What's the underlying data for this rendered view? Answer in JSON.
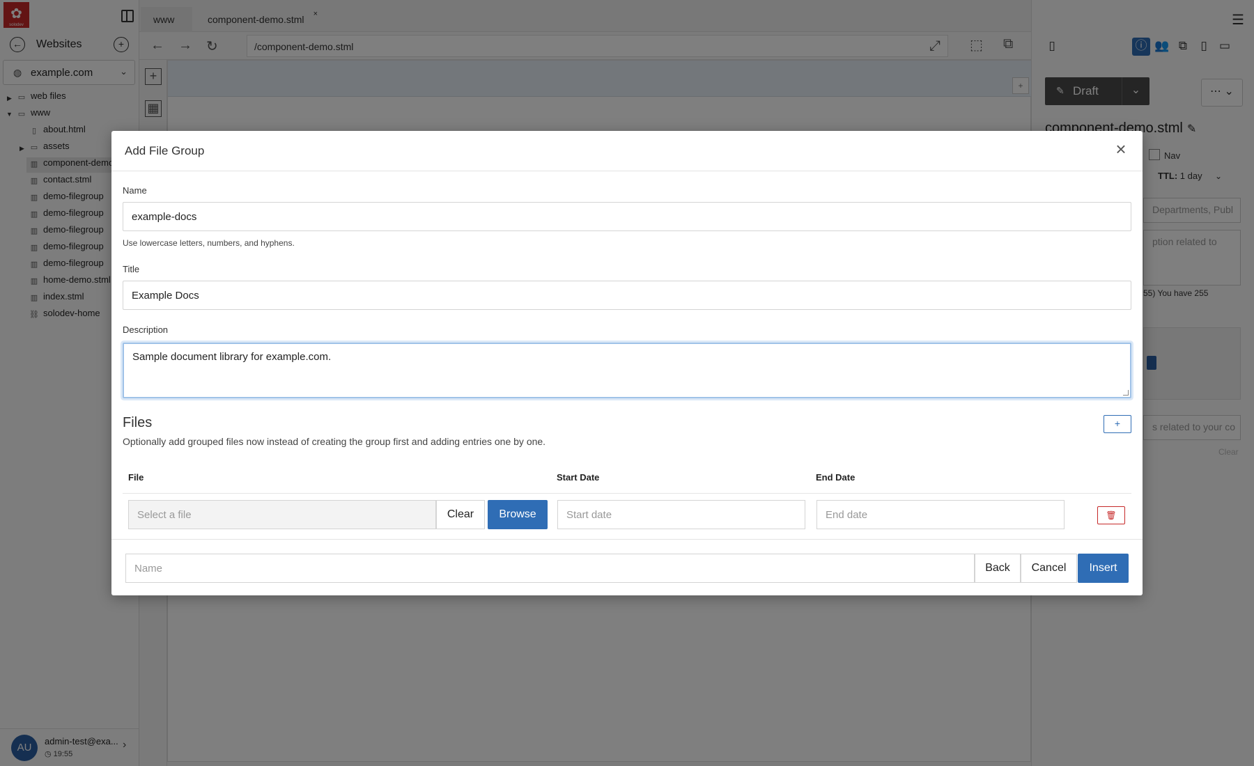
{
  "app": {
    "logo_text": "solodev",
    "colors": {
      "accent": "#2f6db5",
      "brand": "#c62828",
      "danger": "#c62828",
      "avatar": "#2b5fa3"
    }
  },
  "sidebar": {
    "title": "Websites",
    "site": "example.com",
    "tree": [
      {
        "label": "web files",
        "type": "folder"
      },
      {
        "label": "www",
        "type": "folder"
      },
      {
        "label": "about.html",
        "type": "file"
      },
      {
        "label": "assets",
        "type": "folder"
      },
      {
        "label": "component-demo.stml",
        "type": "stml"
      },
      {
        "label": "contact.stml",
        "type": "stml"
      },
      {
        "label": "demo-filegroup",
        "type": "stml"
      },
      {
        "label": "demo-filegroup",
        "type": "stml"
      },
      {
        "label": "demo-filegroup",
        "type": "stml"
      },
      {
        "label": "demo-filegroup",
        "type": "stml"
      },
      {
        "label": "demo-filegroup",
        "type": "stml"
      },
      {
        "label": "home-demo.stml",
        "type": "stml"
      },
      {
        "label": "index.stml",
        "type": "stml"
      },
      {
        "label": "solodev-home",
        "type": "link"
      }
    ],
    "user": {
      "initials": "AU",
      "name": "admin-test@exa...",
      "time": "19:55"
    }
  },
  "editor": {
    "tabs": [
      "www",
      "component-demo.stml"
    ],
    "url": "/component-demo.stml"
  },
  "right_panel": {
    "status": "Draft",
    "file_title": "component-demo.stml",
    "nav_label": "Nav",
    "ttl_label": "TTL:",
    "ttl_value": "1 day",
    "field_categories": "Departments, Publ",
    "field_desc": "ption related to",
    "char_hint": "55) You have 255",
    "field_related": "s related to your co",
    "clear_label": "Clear"
  },
  "modal": {
    "title": "Add File Group",
    "name_label": "Name",
    "name_value": "example-docs",
    "name_help": "Use lowercase letters, numbers, and hyphens.",
    "title_label": "Title",
    "title_value": "Example Docs",
    "description_label": "Description",
    "description_value": "Sample document library for example.com.",
    "files_heading": "Files",
    "files_desc": "Optionally add grouped files now instead of creating the group first and adding entries one by one.",
    "add_row_label": "+",
    "columns": {
      "file": "File",
      "start": "Start Date",
      "end": "End Date"
    },
    "row": {
      "file_placeholder": "Select a file",
      "clear_label": "Clear",
      "browse_label": "Browse",
      "start_placeholder": "Start date",
      "end_placeholder": "End date"
    },
    "footer": {
      "name_placeholder": "Name",
      "back_label": "Back",
      "cancel_label": "Cancel",
      "insert_label": "Insert"
    }
  }
}
